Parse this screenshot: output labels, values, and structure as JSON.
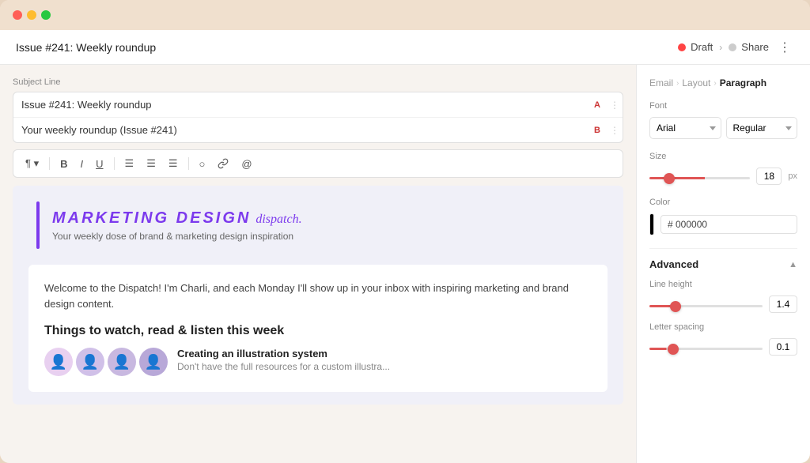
{
  "window": {
    "title": "Issue #241: Weekly roundup"
  },
  "header": {
    "title": "Issue #241: Weekly roundup",
    "draft_label": "Draft",
    "share_label": "Share",
    "more_icon": "⋮"
  },
  "editor": {
    "subject_line_label": "Subject Line",
    "subject_a": "Issue #241: Weekly roundup",
    "subject_b": "Your weekly roundup (Issue #241)",
    "badge_a": "A",
    "badge_b": "B"
  },
  "toolbar": {
    "paragraph_label": "¶",
    "bold": "B",
    "italic": "I",
    "underline": "U",
    "align_left": "≡",
    "align_center": "≡",
    "align_right": "≡",
    "circle": "○",
    "link": "🔗",
    "mention": "@"
  },
  "email_preview": {
    "logo_main": "Marketing Design",
    "logo_script": "dispatch.",
    "tagline": "Your weekly dose of brand & marketing design inspiration",
    "intro": "Welcome to the Dispatch! I'm Charli, and each Monday I'll show up in your inbox with inspiring marketing and brand design content.",
    "section_title": "Things to watch, read & listen this week",
    "article_title": "Creating an illustration system",
    "article_desc": "Don't have the full resources for a custom illustra..."
  },
  "right_panel": {
    "breadcrumb": {
      "email": "Email",
      "layout": "Layout",
      "paragraph": "Paragraph"
    },
    "font_label": "Font",
    "font_family": "Arial",
    "font_style": "Regular",
    "size_label": "Size",
    "size_value": "18",
    "size_unit": "px",
    "color_label": "Color",
    "color_hex": "# 000000",
    "advanced_label": "Advanced",
    "line_height_label": "Line height",
    "line_height_value": "1.4",
    "letter_spacing_label": "Letter spacing",
    "letter_spacing_value": "0.1"
  }
}
